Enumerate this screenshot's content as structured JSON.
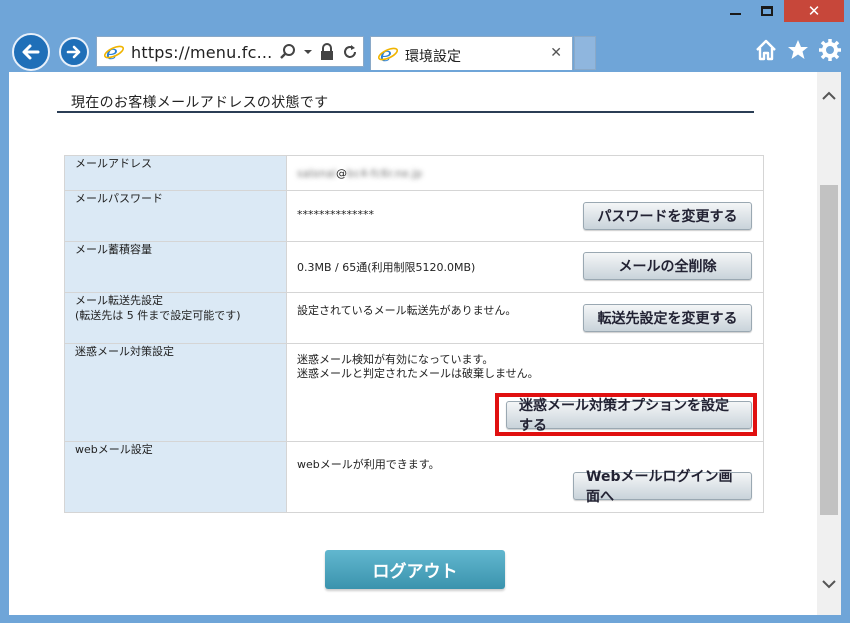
{
  "browser": {
    "address_text": "https://menu.fc...",
    "tab_title": "環境設定",
    "tab_close": "✕"
  },
  "page": {
    "section_title": "現在のお客様メールアドレスの状態です",
    "rows": [
      {
        "label": "メールアドレス",
        "value": "salonal@bc4-fc6r.ne.jp",
        "value_visible": "@"
      },
      {
        "label": "メールパスワード",
        "value": "**************",
        "button": "パスワードを変更する"
      },
      {
        "label": "メール蓄積容量",
        "value": "0.3MB / 65通(利用制限5120.0MB)",
        "button": "メールの全削除"
      },
      {
        "label": "メール転送先設定",
        "label2": "(転送先は 5 件まで設定可能です)",
        "value": "設定されているメール転送先がありません。",
        "button": "転送先設定を変更する"
      },
      {
        "label": "迷惑メール対策設定",
        "value": "迷惑メール検知が有効になっています。",
        "value2": "迷惑メールと判定されたメールは破棄しません。",
        "button": "迷惑メール対策オプションを設定する"
      },
      {
        "label": "webメール設定",
        "value": "webメールが利用できます。",
        "button": "Webメールログイン画面へ"
      }
    ],
    "logout_label": "ログアウト"
  },
  "colors": {
    "highlight": "#e01010",
    "logout": "#4aa6c1",
    "label_bg": "#dbe9f5"
  }
}
